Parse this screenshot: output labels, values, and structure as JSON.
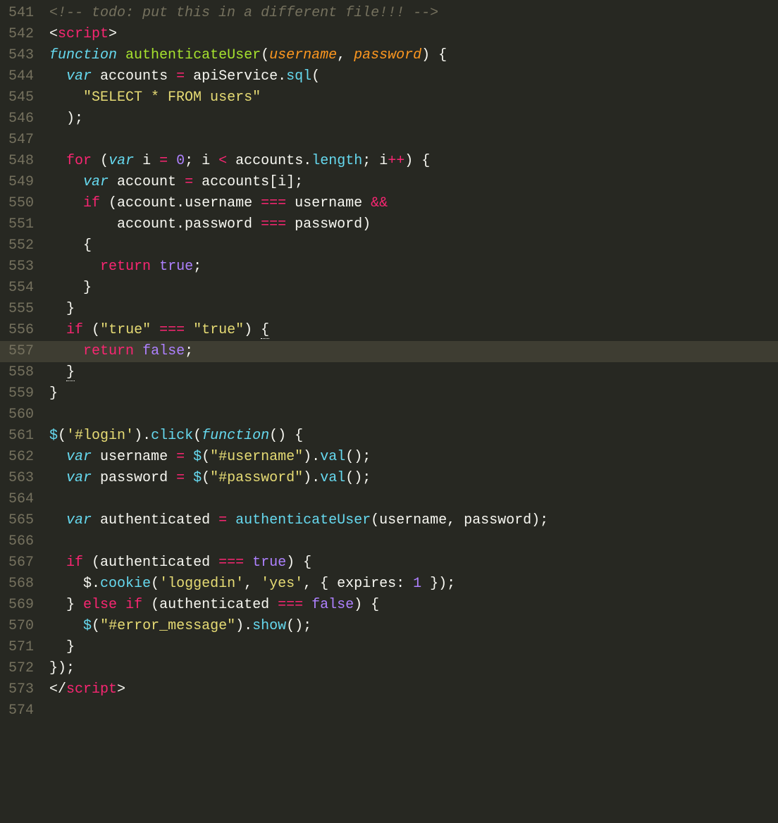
{
  "startLine": 541,
  "highlightLine": 557,
  "lines": [
    {
      "n": 541,
      "tokens": [
        {
          "t": "<!-- todo: put this in a different file!!! -->",
          "c": "tok-comment"
        }
      ]
    },
    {
      "n": 542,
      "tokens": [
        {
          "t": "<",
          "c": "tok-def"
        },
        {
          "t": "script",
          "c": "tok-tag"
        },
        {
          "t": ">",
          "c": "tok-def"
        }
      ]
    },
    {
      "n": 543,
      "tokens": [
        {
          "t": "function",
          "c": "tok-storage"
        },
        {
          "t": " ",
          "c": "tok-def"
        },
        {
          "t": "authenticateUser",
          "c": "tok-fn"
        },
        {
          "t": "(",
          "c": "tok-punct"
        },
        {
          "t": "username",
          "c": "tok-param"
        },
        {
          "t": ",",
          "c": "tok-punct"
        },
        {
          "t": " ",
          "c": "tok-def"
        },
        {
          "t": "password",
          "c": "tok-param"
        },
        {
          "t": ")",
          "c": "tok-punct"
        },
        {
          "t": " {",
          "c": "tok-def"
        }
      ]
    },
    {
      "n": 544,
      "tokens": [
        {
          "t": "  ",
          "c": "tok-def"
        },
        {
          "t": "var",
          "c": "tok-storage"
        },
        {
          "t": " accounts ",
          "c": "tok-def"
        },
        {
          "t": "=",
          "c": "tok-op"
        },
        {
          "t": " apiService.",
          "c": "tok-def"
        },
        {
          "t": "sql",
          "c": "tok-call"
        },
        {
          "t": "(",
          "c": "tok-def"
        }
      ]
    },
    {
      "n": 545,
      "tokens": [
        {
          "t": "    ",
          "c": "tok-def"
        },
        {
          "t": "\"SELECT * FROM users\"",
          "c": "tok-str"
        }
      ]
    },
    {
      "n": 546,
      "tokens": [
        {
          "t": "  );",
          "c": "tok-def"
        }
      ]
    },
    {
      "n": 547,
      "tokens": []
    },
    {
      "n": 548,
      "tokens": [
        {
          "t": "  ",
          "c": "tok-def"
        },
        {
          "t": "for",
          "c": "tok-kw"
        },
        {
          "t": " (",
          "c": "tok-def"
        },
        {
          "t": "var",
          "c": "tok-storage"
        },
        {
          "t": " i ",
          "c": "tok-def"
        },
        {
          "t": "=",
          "c": "tok-op"
        },
        {
          "t": " ",
          "c": "tok-def"
        },
        {
          "t": "0",
          "c": "tok-num"
        },
        {
          "t": "; i ",
          "c": "tok-def"
        },
        {
          "t": "<",
          "c": "tok-op"
        },
        {
          "t": " accounts.",
          "c": "tok-def"
        },
        {
          "t": "length",
          "c": "tok-prop"
        },
        {
          "t": "; i",
          "c": "tok-def"
        },
        {
          "t": "++",
          "c": "tok-op"
        },
        {
          "t": ") {",
          "c": "tok-def"
        }
      ]
    },
    {
      "n": 549,
      "tokens": [
        {
          "t": "    ",
          "c": "tok-def"
        },
        {
          "t": "var",
          "c": "tok-storage"
        },
        {
          "t": " account ",
          "c": "tok-def"
        },
        {
          "t": "=",
          "c": "tok-op"
        },
        {
          "t": " accounts[i];",
          "c": "tok-def"
        }
      ]
    },
    {
      "n": 550,
      "tokens": [
        {
          "t": "    ",
          "c": "tok-def"
        },
        {
          "t": "if",
          "c": "tok-kw"
        },
        {
          "t": " (account.username ",
          "c": "tok-def"
        },
        {
          "t": "===",
          "c": "tok-op"
        },
        {
          "t": " username ",
          "c": "tok-def"
        },
        {
          "t": "&&",
          "c": "tok-op"
        }
      ]
    },
    {
      "n": 551,
      "tokens": [
        {
          "t": "        account.password ",
          "c": "tok-def"
        },
        {
          "t": "===",
          "c": "tok-op"
        },
        {
          "t": " password)",
          "c": "tok-def"
        }
      ]
    },
    {
      "n": 552,
      "tokens": [
        {
          "t": "    {",
          "c": "tok-def"
        }
      ]
    },
    {
      "n": 553,
      "tokens": [
        {
          "t": "      ",
          "c": "tok-def"
        },
        {
          "t": "return",
          "c": "tok-kw"
        },
        {
          "t": " ",
          "c": "tok-def"
        },
        {
          "t": "true",
          "c": "tok-bool"
        },
        {
          "t": ";",
          "c": "tok-def"
        }
      ]
    },
    {
      "n": 554,
      "tokens": [
        {
          "t": "    }",
          "c": "tok-def"
        }
      ]
    },
    {
      "n": 555,
      "tokens": [
        {
          "t": "  }",
          "c": "tok-def"
        }
      ]
    },
    {
      "n": 556,
      "tokens": [
        {
          "t": "  ",
          "c": "tok-def"
        },
        {
          "t": "if",
          "c": "tok-kw"
        },
        {
          "t": " (",
          "c": "tok-def"
        },
        {
          "t": "\"true\"",
          "c": "tok-str"
        },
        {
          "t": " ",
          "c": "tok-def"
        },
        {
          "t": "===",
          "c": "tok-op"
        },
        {
          "t": " ",
          "c": "tok-def"
        },
        {
          "t": "\"true\"",
          "c": "tok-str"
        },
        {
          "t": ") ",
          "c": "tok-def"
        },
        {
          "t": "{",
          "c": "tok-def underline"
        }
      ]
    },
    {
      "n": 557,
      "tokens": [
        {
          "t": "    ",
          "c": "tok-def"
        },
        {
          "t": "return",
          "c": "tok-kw"
        },
        {
          "t": " ",
          "c": "tok-def"
        },
        {
          "t": "false",
          "c": "tok-bool"
        },
        {
          "t": ";",
          "c": "tok-def"
        }
      ]
    },
    {
      "n": 558,
      "tokens": [
        {
          "t": "  ",
          "c": "tok-def"
        },
        {
          "t": "}",
          "c": "tok-def underline"
        }
      ]
    },
    {
      "n": 559,
      "tokens": [
        {
          "t": "}",
          "c": "tok-def"
        }
      ]
    },
    {
      "n": 560,
      "tokens": []
    },
    {
      "n": 561,
      "tokens": [
        {
          "t": "$",
          "c": "tok-call"
        },
        {
          "t": "(",
          "c": "tok-def"
        },
        {
          "t": "'#login'",
          "c": "tok-str"
        },
        {
          "t": ").",
          "c": "tok-def"
        },
        {
          "t": "click",
          "c": "tok-call"
        },
        {
          "t": "(",
          "c": "tok-def"
        },
        {
          "t": "function",
          "c": "tok-storage"
        },
        {
          "t": "() {",
          "c": "tok-def"
        }
      ]
    },
    {
      "n": 562,
      "tokens": [
        {
          "t": "  ",
          "c": "tok-def"
        },
        {
          "t": "var",
          "c": "tok-storage"
        },
        {
          "t": " username ",
          "c": "tok-def"
        },
        {
          "t": "=",
          "c": "tok-op"
        },
        {
          "t": " ",
          "c": "tok-def"
        },
        {
          "t": "$",
          "c": "tok-call"
        },
        {
          "t": "(",
          "c": "tok-def"
        },
        {
          "t": "\"#username\"",
          "c": "tok-str"
        },
        {
          "t": ").",
          "c": "tok-def"
        },
        {
          "t": "val",
          "c": "tok-call"
        },
        {
          "t": "();",
          "c": "tok-def"
        }
      ]
    },
    {
      "n": 563,
      "tokens": [
        {
          "t": "  ",
          "c": "tok-def"
        },
        {
          "t": "var",
          "c": "tok-storage"
        },
        {
          "t": " password ",
          "c": "tok-def"
        },
        {
          "t": "=",
          "c": "tok-op"
        },
        {
          "t": " ",
          "c": "tok-def"
        },
        {
          "t": "$",
          "c": "tok-call"
        },
        {
          "t": "(",
          "c": "tok-def"
        },
        {
          "t": "\"#password\"",
          "c": "tok-str"
        },
        {
          "t": ").",
          "c": "tok-def"
        },
        {
          "t": "val",
          "c": "tok-call"
        },
        {
          "t": "();",
          "c": "tok-def"
        }
      ]
    },
    {
      "n": 564,
      "tokens": []
    },
    {
      "n": 565,
      "tokens": [
        {
          "t": "  ",
          "c": "tok-def"
        },
        {
          "t": "var",
          "c": "tok-storage"
        },
        {
          "t": " authenticated ",
          "c": "tok-def"
        },
        {
          "t": "=",
          "c": "tok-op"
        },
        {
          "t": " ",
          "c": "tok-def"
        },
        {
          "t": "authenticateUser",
          "c": "tok-call"
        },
        {
          "t": "(username, password);",
          "c": "tok-def"
        }
      ]
    },
    {
      "n": 566,
      "tokens": []
    },
    {
      "n": 567,
      "tokens": [
        {
          "t": "  ",
          "c": "tok-def"
        },
        {
          "t": "if",
          "c": "tok-kw"
        },
        {
          "t": " (authenticated ",
          "c": "tok-def"
        },
        {
          "t": "===",
          "c": "tok-op"
        },
        {
          "t": " ",
          "c": "tok-def"
        },
        {
          "t": "true",
          "c": "tok-bool"
        },
        {
          "t": ") {",
          "c": "tok-def"
        }
      ]
    },
    {
      "n": 568,
      "tokens": [
        {
          "t": "    $.",
          "c": "tok-def"
        },
        {
          "t": "cookie",
          "c": "tok-call"
        },
        {
          "t": "(",
          "c": "tok-def"
        },
        {
          "t": "'loggedin'",
          "c": "tok-str"
        },
        {
          "t": ", ",
          "c": "tok-def"
        },
        {
          "t": "'yes'",
          "c": "tok-str"
        },
        {
          "t": ", { expires: ",
          "c": "tok-def"
        },
        {
          "t": "1",
          "c": "tok-num"
        },
        {
          "t": " });",
          "c": "tok-def"
        }
      ]
    },
    {
      "n": 569,
      "tokens": [
        {
          "t": "  } ",
          "c": "tok-def"
        },
        {
          "t": "else",
          "c": "tok-kw"
        },
        {
          "t": " ",
          "c": "tok-def"
        },
        {
          "t": "if",
          "c": "tok-kw"
        },
        {
          "t": " (authenticated ",
          "c": "tok-def"
        },
        {
          "t": "===",
          "c": "tok-op"
        },
        {
          "t": " ",
          "c": "tok-def"
        },
        {
          "t": "false",
          "c": "tok-bool"
        },
        {
          "t": ") {",
          "c": "tok-def"
        }
      ]
    },
    {
      "n": 570,
      "tokens": [
        {
          "t": "    ",
          "c": "tok-def"
        },
        {
          "t": "$",
          "c": "tok-call"
        },
        {
          "t": "(",
          "c": "tok-def"
        },
        {
          "t": "\"#error_message\"",
          "c": "tok-str"
        },
        {
          "t": ").",
          "c": "tok-def"
        },
        {
          "t": "show",
          "c": "tok-call"
        },
        {
          "t": "();",
          "c": "tok-def"
        }
      ]
    },
    {
      "n": 571,
      "tokens": [
        {
          "t": "  }",
          "c": "tok-def"
        }
      ]
    },
    {
      "n": 572,
      "tokens": [
        {
          "t": "});",
          "c": "tok-def"
        }
      ]
    },
    {
      "n": 573,
      "tokens": [
        {
          "t": "</",
          "c": "tok-def"
        },
        {
          "t": "script",
          "c": "tok-tag"
        },
        {
          "t": ">",
          "c": "tok-def"
        }
      ]
    },
    {
      "n": 574,
      "tokens": []
    }
  ]
}
